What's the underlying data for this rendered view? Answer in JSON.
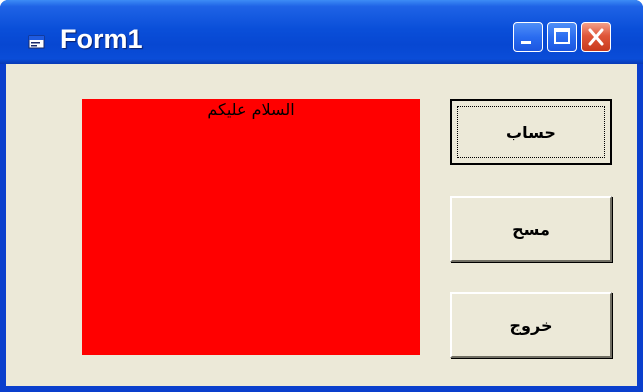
{
  "window": {
    "title": "Form1",
    "titlebar_color": "#0a4fd9",
    "client_color": "#ece9d8",
    "icons": {
      "app": "form-icon",
      "minimize": "minimize-icon",
      "maximize": "maximize-icon",
      "close": "close-icon"
    }
  },
  "label": {
    "text": "السلام عليكم",
    "background": "#ff0000"
  },
  "buttons": {
    "calculate": "حساب",
    "clear": "مسح",
    "exit": "خروج"
  }
}
